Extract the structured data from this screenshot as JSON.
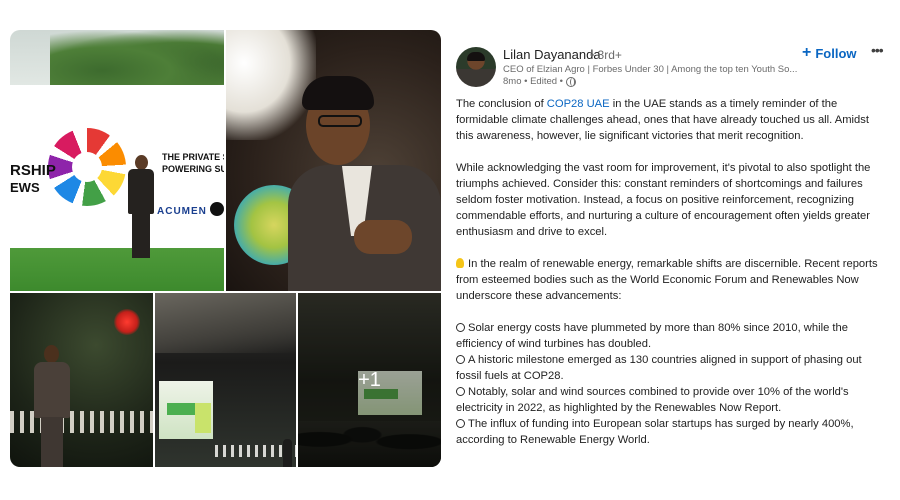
{
  "gallery": {
    "photo1_banner": {
      "line1": "RSHIP",
      "line2": "EWS",
      "line3": "THE PRIVATE SEC",
      "line4": "POWERING SUST",
      "sponsor": "ACUMEN"
    },
    "more_photos_label": "+1"
  },
  "author": {
    "name": "Lilan Dayananda",
    "degree": "• 3rd+",
    "headline": "CEO of Elzian Agro | Forbes Under 30 | Among the top ten Youth So...",
    "time_ago": "8mo • Edited •",
    "visibility_icon": "globe-icon"
  },
  "actions": {
    "follow_plus": "+",
    "follow_label": "Follow",
    "more_label": "•••"
  },
  "post": {
    "p1_before": "The conclusion of ",
    "p1_hashtag": "COP28 UAE",
    "p1_after": " in the UAE stands as a timely reminder of the formidable climate challenges ahead, ones that have already touched us all. Amidst this awareness, however, lie significant victories that merit recognition.",
    "p2": "While acknowledging the vast room for improvement, it's pivotal to also spotlight the triumphs achieved. Consider this: constant reminders of shortcomings and failures seldom foster motivation. Instead, a focus on positive reinforcement, recognizing commendable efforts, and nurturing a culture of encouragement often yields greater enthusiasm and drive to excel.",
    "p3": "In the realm of renewable energy, remarkable shifts are discernible. Recent reports from esteemed bodies such as the World Economic Forum and Renewables Now underscore these advancements:",
    "bullets": [
      "Solar energy costs have plummeted by more than 80% since 2010, while the efficiency of wind turbines has doubled.",
      "A historic milestone emerged as 130 countries aligned in support of phasing out fossil fuels at COP28.",
      "Notably, solar and wind sources combined to provide over 10% of the world's electricity in 2022, as highlighted by the Renewables Now Report.",
      "The influx of funding into European solar startups has surged by nearly 400%, according to Renewable Energy World."
    ]
  },
  "colors": {
    "link_blue": "#0a66c2",
    "text_primary": "#1f1f1f",
    "text_secondary": "#6b6b6b"
  }
}
